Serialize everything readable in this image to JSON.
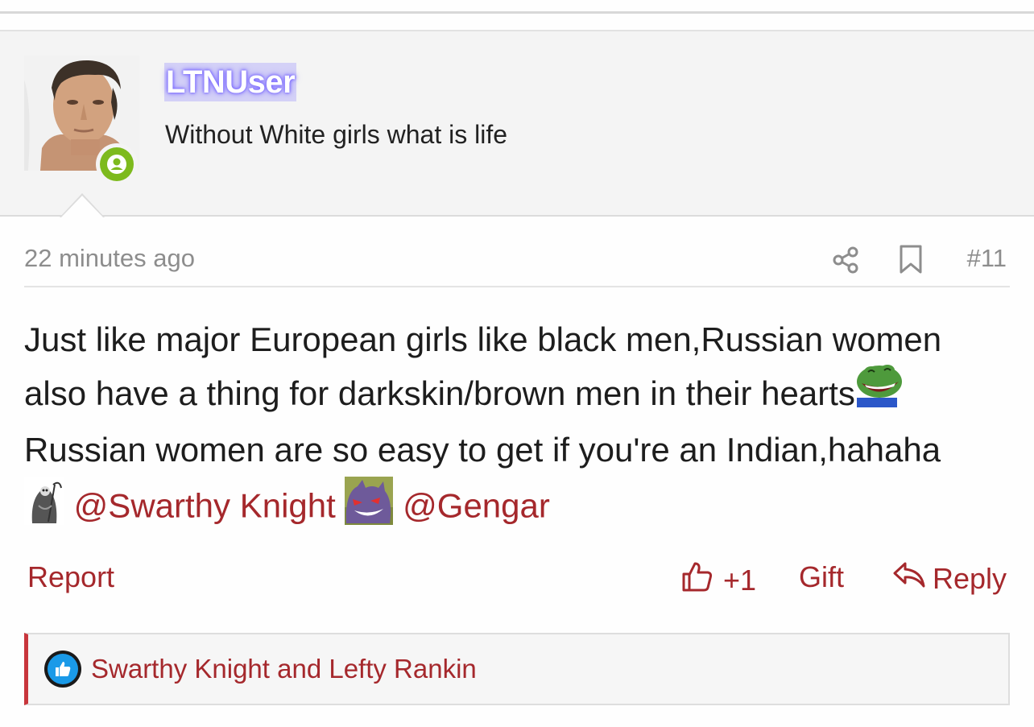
{
  "user": {
    "username": "LTNUser",
    "title": "Without White girls what is life"
  },
  "post": {
    "timestamp": "22 minutes ago",
    "number": "#11",
    "lines": [
      "Just like major European girls like black men,Russian women",
      "also have a thing for darkskin/brown men in their hearts",
      "Russian women are so easy to get if you're an Indian,hahaha"
    ],
    "mentions": [
      "@Swarthy Knight",
      "@Gengar"
    ]
  },
  "actions": {
    "report": "Report",
    "like_count": "+1",
    "gift": "Gift",
    "reply": "Reply"
  },
  "likes": {
    "text": "Swarthy Knight and Lefty Rankin"
  },
  "colors": {
    "accent": "#a5282c",
    "online": "#7dba1d",
    "like_blue": "#1a9ae8"
  }
}
